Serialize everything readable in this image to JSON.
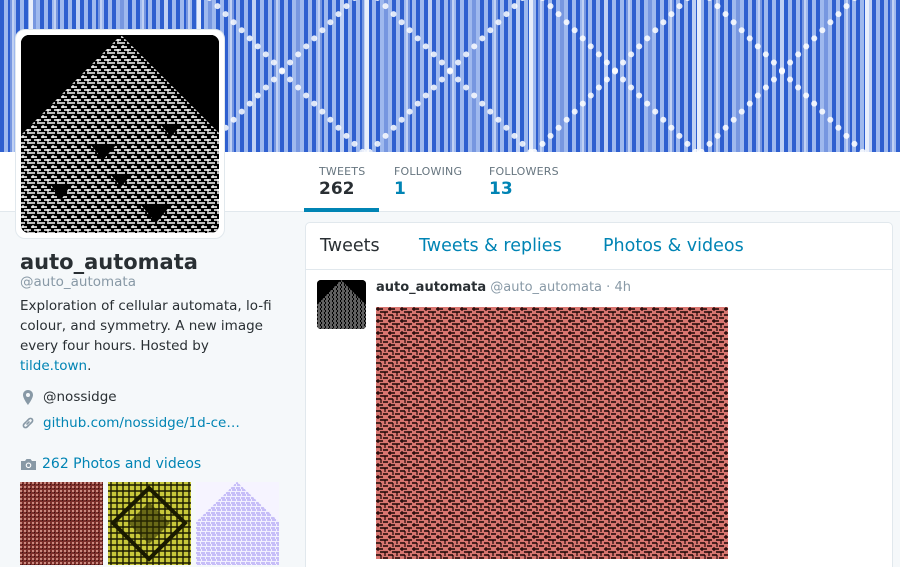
{
  "colors": {
    "accent": "#0084b4",
    "text": "#292f33",
    "muted": "#8899a6",
    "banner_blue": "#3f6fd6",
    "media_pink": "#d87670"
  },
  "stats": [
    {
      "label": "TWEETS",
      "value": "262"
    },
    {
      "label": "FOLLOWING",
      "value": "1"
    },
    {
      "label": "FOLLOWERS",
      "value": "13"
    }
  ],
  "profile": {
    "name": "auto_automata",
    "handle": "@auto_automata",
    "bio_text": "Exploration of cellular automata, lo-fi colour, and symmetry. A new image every four hours. Hosted by",
    "bio_link": "tilde.town",
    "bio_end": ".",
    "location": "@nossidge",
    "website": "github.com/nossidge/1d-ce…",
    "location_icon": "map-pin-icon",
    "website_icon": "link-icon"
  },
  "photos": {
    "label": "262 Photos and videos",
    "icon": "camera-icon"
  },
  "timeline": {
    "tabs": [
      "Tweets",
      "Tweets & replies",
      "Photos & videos"
    ],
    "tweet": {
      "name": "auto_automata",
      "handle": "@auto_automata",
      "separator": "·",
      "time": "4h"
    }
  }
}
